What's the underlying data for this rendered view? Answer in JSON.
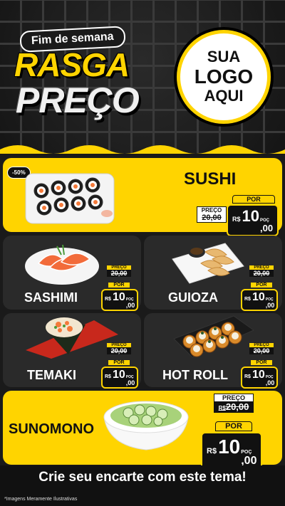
{
  "header": {
    "weekend": "Fim de semana",
    "line1": "RASGA",
    "line2": "PREÇO",
    "logo": [
      "SUA",
      "LOGO",
      "AQUI"
    ]
  },
  "discount_badge": "-50%",
  "labels": {
    "preco": "PREÇO",
    "por": "POR",
    "currency": "R$",
    "unit": "POÇ"
  },
  "products": [
    {
      "name": "SUSHI",
      "old_price": "20,00",
      "new_int": "10",
      "new_dec": ",00"
    },
    {
      "name": "SASHIMI",
      "old_price": "20,00",
      "new_int": "10",
      "new_dec": ",00"
    },
    {
      "name": "GUIOZA",
      "old_price": "20,00",
      "new_int": "10",
      "new_dec": ",00"
    },
    {
      "name": "TEMAKI",
      "old_price": "20,00",
      "new_int": "10",
      "new_dec": ",00"
    },
    {
      "name": "HOT ROLL",
      "old_price": "20,00",
      "new_int": "10",
      "new_dec": ",00"
    },
    {
      "name": "SUNOMONO",
      "old_price": "20,00",
      "new_int": "10",
      "new_dec": ",00"
    }
  ],
  "footer": {
    "cta": "Crie seu encarte com este tema!",
    "disclaimer": "*Imagens Meramente Ilustrativas"
  },
  "colors": {
    "accent": "#ffd400",
    "dark_card": "#2a2a2a",
    "background": "#1a1a1a"
  }
}
